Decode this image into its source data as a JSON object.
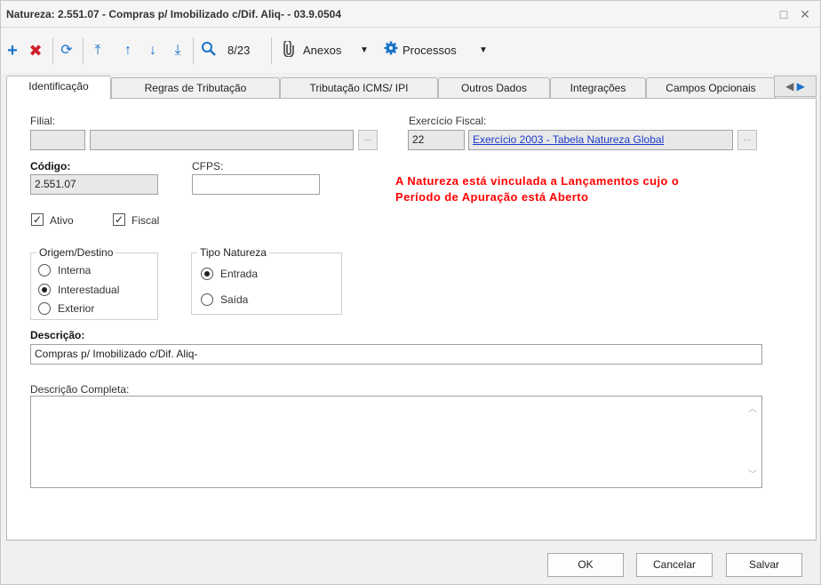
{
  "window": {
    "title": "Natureza: 2.551.07 - Compras p/ Imobilizado c/Dif. Aliq-  - 03.9.0504",
    "restore_symbol": "□",
    "close_symbol": "✕"
  },
  "toolbar": {
    "add_icon": "plus-icon",
    "delete_icon": "x-icon",
    "refresh_icon": "refresh-icon",
    "first_icon": "first-icon",
    "prev_icon": "up-arrow-icon",
    "next_icon": "down-arrow-icon",
    "last_icon": "last-icon",
    "search_icon": "search-icon",
    "record_counter": "8/23",
    "anexos_label": "Anexos",
    "processos_label": "Processos"
  },
  "tabs": [
    {
      "label": "Identificação",
      "active": true
    },
    {
      "label": "Regras de Tributação",
      "active": false
    },
    {
      "label": "Tributação ICMS/ IPI",
      "active": false
    },
    {
      "label": "Outros Dados",
      "active": false
    },
    {
      "label": "Integrações",
      "active": false
    },
    {
      "label": "Campos Opcionais",
      "active": false
    }
  ],
  "form": {
    "filial_label": "Filial:",
    "filial_code": "",
    "filial_name": "",
    "lookup_button": "...",
    "exercicio_label": "Exercício Fiscal:",
    "exercicio_code": "22",
    "exercicio_name": "Exercício 2003 - Tabela Natureza Global",
    "codigo_label": "Código:",
    "codigo_value": "2.551.07",
    "cfps_label": "CFPS:",
    "cfps_value": "",
    "warning_line1": "A Natureza está vinculada a Lançamentos cujo o",
    "warning_line2": "Período de Apuração está Aberto",
    "ativo_label": "Ativo",
    "ativo_checked": true,
    "fiscal_label": "Fiscal",
    "fiscal_checked": true,
    "origem_title": "Origem/Destino",
    "origem_options": [
      {
        "label": "Interna",
        "selected": false
      },
      {
        "label": "Interestadual",
        "selected": true
      },
      {
        "label": "Exterior",
        "selected": false
      }
    ],
    "tipo_title": "Tipo Natureza",
    "tipo_options": [
      {
        "label": "Entrada",
        "selected": true
      },
      {
        "label": "Saída",
        "selected": false
      }
    ],
    "descricao_label": "Descrição:",
    "descricao_value": "Compras p/ Imobilizado c/Dif. Aliq-",
    "descricao_completa_label": "Descrição Completa:",
    "descricao_completa_value": ""
  },
  "footer": {
    "ok_label": "OK",
    "cancelar_label": "Cancelar",
    "salvar_label": "Salvar"
  },
  "colors": {
    "accent_blue": "#1a73c8",
    "delete_red": "#d0202a",
    "warning_red": "#ff0000",
    "link_blue": "#1a3cc8"
  }
}
